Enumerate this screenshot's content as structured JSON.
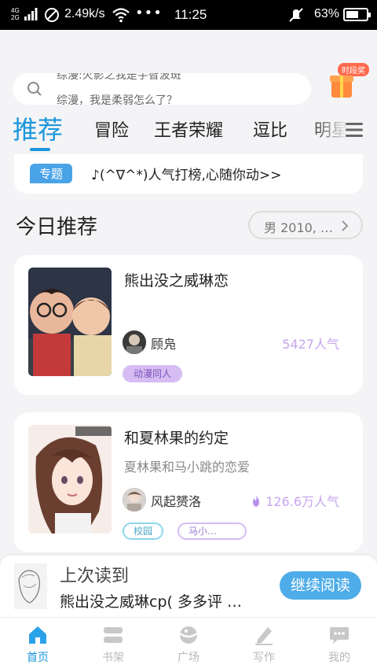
{
  "status_bar": {
    "network_top": "4G",
    "network_bottom": "2G",
    "speed": "2.49k/s",
    "time": "11:25",
    "battery": "63%",
    "battery_level": 0.63
  },
  "search": {
    "line1": "综漫:火影之我是宇智波斑",
    "line2": "综漫，我是柔弱怎么了？"
  },
  "gift": {
    "badge": "时段奖"
  },
  "tabs": [
    {
      "label": "推荐",
      "active": true
    },
    {
      "label": "冒险",
      "active": false
    },
    {
      "label": "王者荣耀",
      "active": false
    },
    {
      "label": "逗比",
      "active": false
    },
    {
      "label": "明星",
      "active": false
    }
  ],
  "topic": {
    "tag": "专题",
    "text": "♪(^∇^*)人气打榜,心随你动>>"
  },
  "section": {
    "title": "今日推荐",
    "filter": "男 2010, …"
  },
  "books": [
    {
      "title": "熊出没之威琳恋",
      "description": "",
      "author": "顾凫",
      "popularity": "5427人气",
      "tags": [
        "动漫同人"
      ]
    },
    {
      "title": "和夏林果的约定",
      "description": "夏林果和马小跳的恋爱",
      "author": "风起赟洛",
      "popularity": "126.6万人气",
      "tags": [
        "校园",
        "马小…"
      ]
    }
  ],
  "continue_reading": {
    "label": "上次读到",
    "book": "熊出没之威琳cp( 多多评 …",
    "button": "继续阅读"
  },
  "bottom_nav": [
    {
      "label": "首页",
      "icon": "home-icon",
      "active": true
    },
    {
      "label": "书架",
      "icon": "bookshelf-icon",
      "active": false
    },
    {
      "label": "广场",
      "icon": "square-icon",
      "active": false
    },
    {
      "label": "写作",
      "icon": "write-icon",
      "active": false
    },
    {
      "label": "我的",
      "icon": "profile-icon",
      "active": false
    }
  ],
  "colors": {
    "accent": "#1a96dc",
    "popularity": "#c7a5ee",
    "button": "#4eace8"
  }
}
